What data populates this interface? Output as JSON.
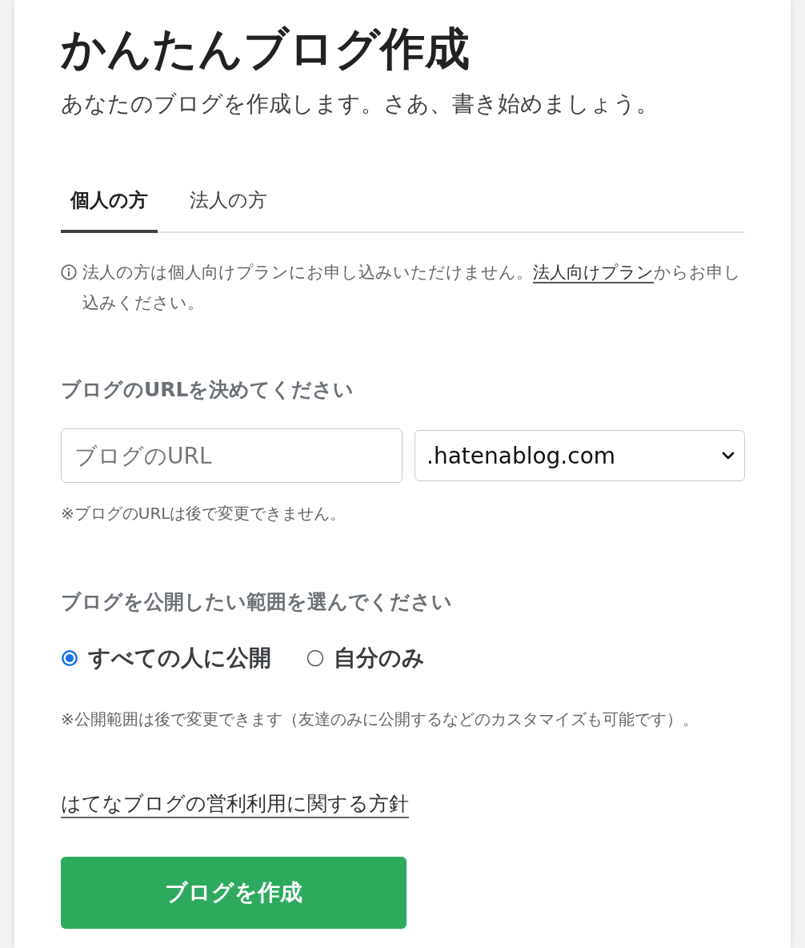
{
  "header": {
    "title": "かんたんブログ作成",
    "subtitle": "あなたのブログを作成します。さあ、書き始めましょう。"
  },
  "tabs": [
    {
      "label": "個人の方",
      "selected": true
    },
    {
      "label": "法人の方",
      "selected": false
    }
  ],
  "notice": {
    "text_before": "法人の方は個人向けプランにお申し込みいただけません。",
    "link": "法人向けプラン",
    "text_after": "からお申し込みください。"
  },
  "url_section": {
    "label": "ブログのURLを決めてください",
    "url_field": {
      "placeholder": "ブログのURL"
    },
    "domain_select": {
      "value": ".hatenablog.com"
    },
    "note": "※ブログのURLは後で変更できません。"
  },
  "visibility_section": {
    "label": "ブログを公開したい範囲を選んでください",
    "options": [
      {
        "label": "すべての人に公開",
        "selected": true
      },
      {
        "label": "自分のみ",
        "selected": false
      }
    ],
    "note": "※公開範囲は後で変更できます（友達のみに公開するなどのカスタマイズも可能です）。"
  },
  "policy_link": "はてなブログの営利利用に関する方針",
  "submit_button": "ブログを作成"
}
